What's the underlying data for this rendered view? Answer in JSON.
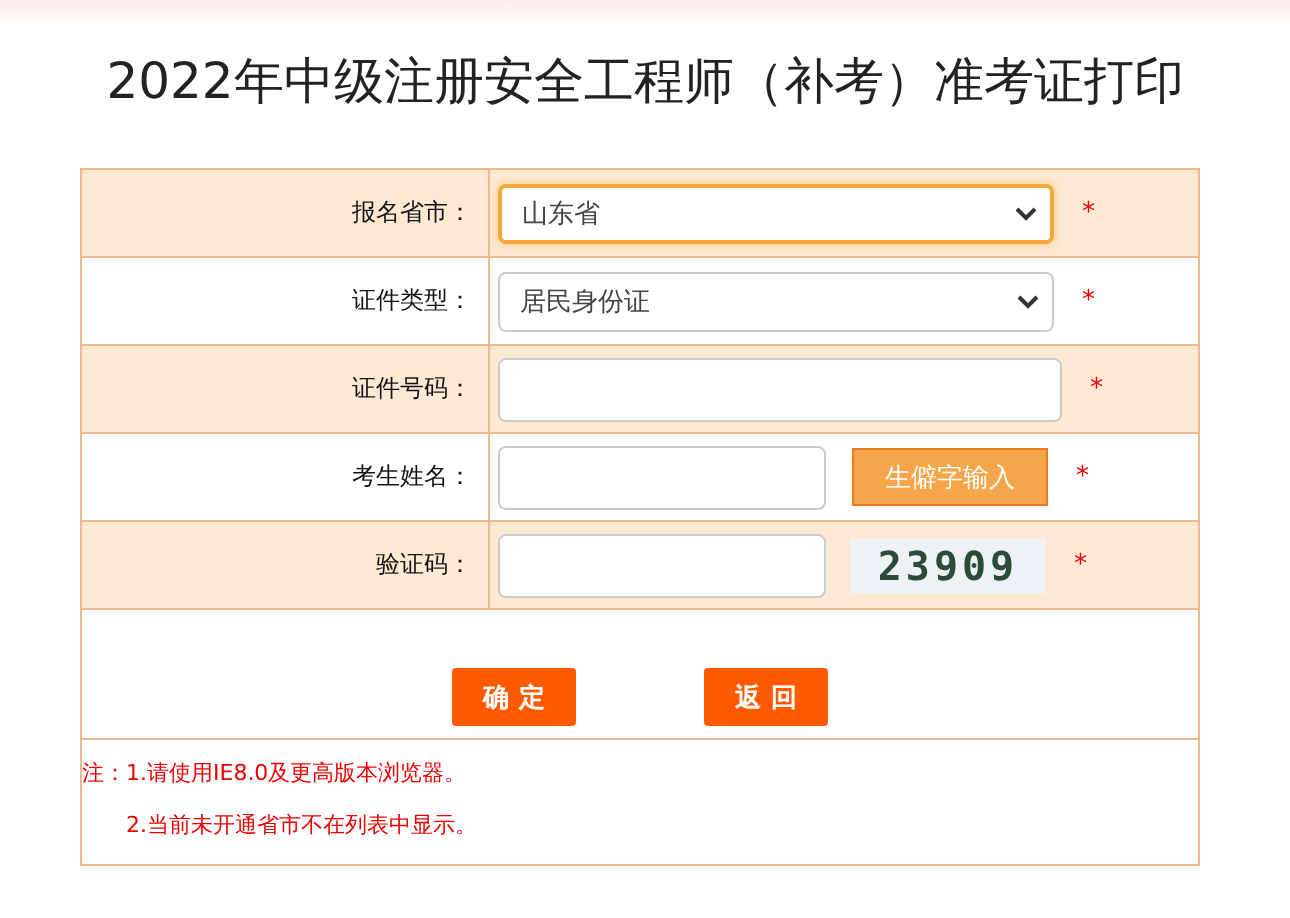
{
  "title": "2022年中级注册安全工程师（补考）准考证打印",
  "rows": [
    {
      "kind": "select",
      "label": "报名省市：",
      "value": "山东省",
      "focused": true,
      "required_mark": "*"
    },
    {
      "kind": "select",
      "label": "证件类型：",
      "value": "居民身份证",
      "focused": false,
      "required_mark": "*"
    },
    {
      "kind": "input",
      "label": "证件号码：",
      "required_mark": "*"
    },
    {
      "kind": "input_button",
      "label": "考生姓名：",
      "button": "生僻字输入",
      "required_mark": "*"
    },
    {
      "kind": "captcha",
      "label": "验证码：",
      "captcha": "23909",
      "required_mark": "*"
    }
  ],
  "buttons": [
    "确 定",
    "返 回"
  ],
  "notes": [
    "注：1.请使用IE8.0及更高版本浏览器。",
    "2.当前未开通省市不在列表中显示。"
  ]
}
